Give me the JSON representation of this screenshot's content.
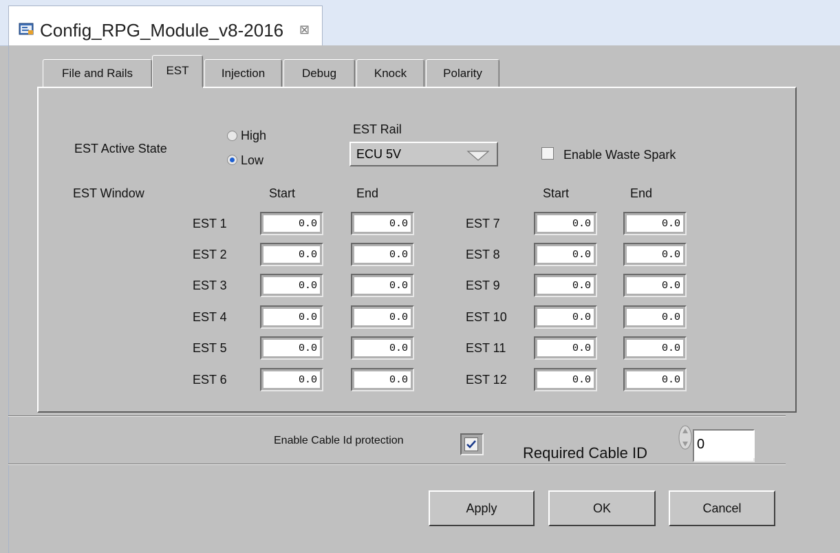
{
  "editor_tab": {
    "title": "Config_RPG_Module_v8-2016",
    "close_glyph": "⊠"
  },
  "tabs": [
    {
      "label": "File and Rails",
      "active": false
    },
    {
      "label": "EST",
      "active": true
    },
    {
      "label": "Injection",
      "active": false
    },
    {
      "label": "Debug",
      "active": false
    },
    {
      "label": "Knock",
      "active": false
    },
    {
      "label": "Polarity",
      "active": false
    }
  ],
  "est": {
    "active_state_label": "EST Active State",
    "radio_high": "High",
    "radio_low": "Low",
    "selected_state": "Low",
    "rail_label": "EST Rail",
    "rail_value": "ECU 5V",
    "waste_spark_label": "Enable Waste Spark",
    "waste_spark_checked": false,
    "window_label": "EST Window",
    "start_header": "Start",
    "end_header": "End",
    "left_rows": [
      {
        "label": "EST 1",
        "start": "0.0",
        "end": "0.0"
      },
      {
        "label": "EST 2",
        "start": "0.0",
        "end": "0.0"
      },
      {
        "label": "EST 3",
        "start": "0.0",
        "end": "0.0"
      },
      {
        "label": "EST 4",
        "start": "0.0",
        "end": "0.0"
      },
      {
        "label": "EST 5",
        "start": "0.0",
        "end": "0.0"
      },
      {
        "label": "EST 6",
        "start": "0.0",
        "end": "0.0"
      }
    ],
    "right_rows": [
      {
        "label": "EST 7",
        "start": "0.0",
        "end": "0.0"
      },
      {
        "label": "EST 8",
        "start": "0.0",
        "end": "0.0"
      },
      {
        "label": "EST 9",
        "start": "0.0",
        "end": "0.0"
      },
      {
        "label": "EST 10",
        "start": "0.0",
        "end": "0.0"
      },
      {
        "label": "EST 11",
        "start": "0.0",
        "end": "0.0"
      },
      {
        "label": "EST 12",
        "start": "0.0",
        "end": "0.0"
      }
    ]
  },
  "cable": {
    "enable_label": "Enable Cable Id protection",
    "enable_checked": true,
    "required_label": "Required Cable ID",
    "required_value": "0"
  },
  "buttons": {
    "apply": "Apply",
    "ok": "OK",
    "cancel": "Cancel"
  },
  "colors": {
    "background": "#c0c0c0",
    "radio_selected": "#1d5fd2",
    "check_mark": "#1a3a8a"
  }
}
